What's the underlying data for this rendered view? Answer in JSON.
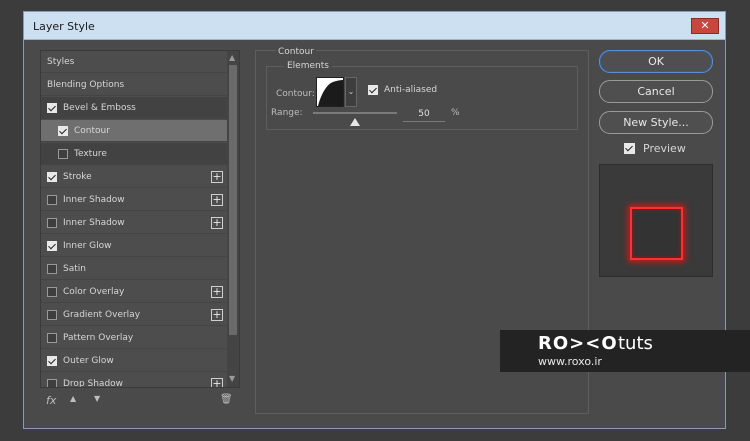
{
  "window": {
    "title": "Layer Style",
    "close_symbol": "✕"
  },
  "styles_list": [
    {
      "label": "Styles",
      "checkbox": false,
      "checked": false,
      "plus": false,
      "state": "header"
    },
    {
      "label": "Blending Options",
      "checkbox": false,
      "checked": false,
      "plus": false,
      "state": "header"
    },
    {
      "label": "Bevel & Emboss",
      "checkbox": true,
      "checked": true,
      "plus": false,
      "state": "dark"
    },
    {
      "label": "Contour",
      "checkbox": true,
      "checked": true,
      "plus": false,
      "state": "selected",
      "indent": true
    },
    {
      "label": "Texture",
      "checkbox": true,
      "checked": false,
      "plus": false,
      "state": "dark",
      "indent": true
    },
    {
      "label": "Stroke",
      "checkbox": true,
      "checked": true,
      "plus": true,
      "state": "normal"
    },
    {
      "label": "Inner Shadow",
      "checkbox": true,
      "checked": false,
      "plus": true,
      "state": "normal"
    },
    {
      "label": "Inner Shadow",
      "checkbox": true,
      "checked": false,
      "plus": true,
      "state": "normal"
    },
    {
      "label": "Inner Glow",
      "checkbox": true,
      "checked": true,
      "plus": false,
      "state": "normal"
    },
    {
      "label": "Satin",
      "checkbox": true,
      "checked": false,
      "plus": false,
      "state": "normal"
    },
    {
      "label": "Color Overlay",
      "checkbox": true,
      "checked": false,
      "plus": true,
      "state": "normal"
    },
    {
      "label": "Gradient Overlay",
      "checkbox": true,
      "checked": false,
      "plus": true,
      "state": "normal"
    },
    {
      "label": "Pattern Overlay",
      "checkbox": true,
      "checked": false,
      "plus": false,
      "state": "normal"
    },
    {
      "label": "Outer Glow",
      "checkbox": true,
      "checked": true,
      "plus": false,
      "state": "normal"
    },
    {
      "label": "Drop Shadow",
      "checkbox": true,
      "checked": false,
      "plus": true,
      "state": "normal"
    }
  ],
  "bottom_bar": {
    "fx_label": "fx",
    "up_icon": "▲",
    "down_icon": "▼",
    "trash_icon": "🗑"
  },
  "panel": {
    "title": "Contour",
    "group_title": "Elements",
    "contour_label": "Contour:",
    "antialiased_label": "Anti-aliased",
    "antialiased_checked": true,
    "range_label": "Range:",
    "range_value": "50",
    "range_unit": "%",
    "range_fraction": 0.5
  },
  "buttons": {
    "ok": "OK",
    "cancel": "Cancel",
    "new_style": "New Style..."
  },
  "preview": {
    "label": "Preview",
    "checked": true,
    "glow_color": "#ff2a2a"
  },
  "watermark": {
    "brand": "RO><O",
    "tuts": "tuts",
    "url": "www.roxo.ir"
  }
}
